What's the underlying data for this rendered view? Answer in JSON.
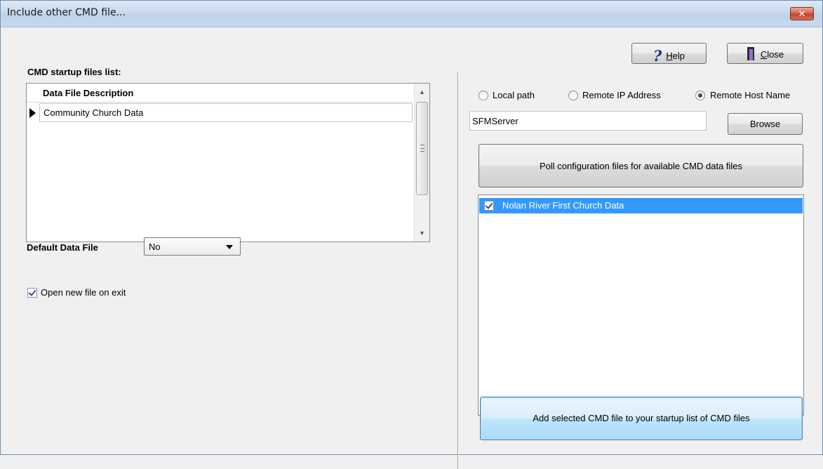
{
  "window": {
    "title": "Include other CMD file...",
    "close_glyph": "✕"
  },
  "toolbar": {
    "help_label": "Help",
    "help_accel": "H",
    "help_rest": "elp",
    "close_label": "Close",
    "close_accel": "C",
    "close_rest": "lose"
  },
  "left": {
    "list_label": "CMD startup files list:",
    "grid": {
      "header": "Data File Description",
      "rows": [
        {
          "description": "Community Church Data"
        }
      ]
    },
    "default_label": "Default Data File",
    "default_value": "No",
    "open_on_exit_label": "Open new file on exit",
    "open_on_exit_checked": true
  },
  "right": {
    "source_options": [
      {
        "label": "Local path",
        "selected": false
      },
      {
        "label": "Remote IP Address",
        "selected": false
      },
      {
        "label": "Remote Host Name",
        "selected": true
      }
    ],
    "host_value": "SFMServer",
    "browse_label": "Browse",
    "poll_label": "Poll configuration files for available CMD data files",
    "available_files": [
      {
        "label": "Nolan River First Church Data",
        "checked": true,
        "selected": true
      }
    ],
    "add_label": "Add selected CMD file to your startup list of CMD files"
  },
  "colors": {
    "selection": "#3399ff",
    "window_bg": "#f0f0f0",
    "close_red": "#c0402a"
  },
  "icons": {
    "help": "question-mark-icon",
    "close": "door-exit-icon"
  }
}
